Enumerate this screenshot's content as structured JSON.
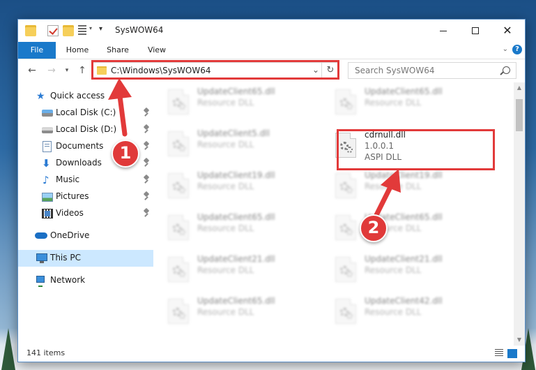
{
  "window": {
    "title": "SysWOW64"
  },
  "ribbon": {
    "tabs": [
      "File",
      "Home",
      "Share",
      "View"
    ],
    "help": "?"
  },
  "nav": {
    "address": "C:\\Windows\\SysWOW64",
    "search_placeholder": "Search SysWOW64"
  },
  "sidebar": {
    "items": [
      {
        "label": "Quick access",
        "icon": "star-icon",
        "pinned": false
      },
      {
        "label": "Local Disk (C:)",
        "icon": "drive-icon",
        "pinned": true
      },
      {
        "label": "Local Disk (D:)",
        "icon": "drive-icon",
        "pinned": true
      },
      {
        "label": "Documents",
        "icon": "documents-icon",
        "pinned": true
      },
      {
        "label": "Downloads",
        "icon": "download-icon",
        "pinned": true
      },
      {
        "label": "Music",
        "icon": "music-icon",
        "pinned": true
      },
      {
        "label": "Pictures",
        "icon": "pictures-icon",
        "pinned": true
      },
      {
        "label": "Videos",
        "icon": "videos-icon",
        "pinned": true
      },
      {
        "label": "OneDrive",
        "icon": "cloud-icon",
        "pinned": false
      },
      {
        "label": "This PC",
        "icon": "computer-icon",
        "pinned": false,
        "selected": true
      },
      {
        "label": "Network",
        "icon": "network-icon",
        "pinned": false
      }
    ]
  },
  "files": {
    "left": [
      {
        "name": "UpdateClient65.dll",
        "desc": "Resource DLL"
      },
      {
        "name": "UpdateClient5.dll",
        "desc": "Resource DLL"
      },
      {
        "name": "UpdateClient19.dll",
        "desc": "Resource DLL"
      },
      {
        "name": "UpdateClient65.dll",
        "desc": "Resource DLL"
      },
      {
        "name": "UpdateClient21.dll",
        "desc": "Resource DLL"
      },
      {
        "name": "UpdateClient65.dll",
        "desc": "Resource DLL"
      }
    ],
    "right": [
      {
        "name": "UpdateClient65.dll",
        "desc": "Resource DLL"
      },
      {
        "name": "UpdateClient19.dll",
        "desc": "Resource DLL"
      },
      {
        "name": "UpdateClient65.dll",
        "desc": "Resource DLL"
      },
      {
        "name": "UpdateClient21.dll",
        "desc": "Resource DLL"
      },
      {
        "name": "UpdateClient42.dll",
        "desc": "Resource DLL"
      }
    ],
    "featured": {
      "name": "cdrnull.dll",
      "version": "1.0.0.1",
      "desc": "ASPI DLL"
    }
  },
  "status": {
    "item_count": "141 items"
  },
  "annotations": {
    "step1": "1",
    "step2": "2",
    "color": "#e23a3a"
  }
}
